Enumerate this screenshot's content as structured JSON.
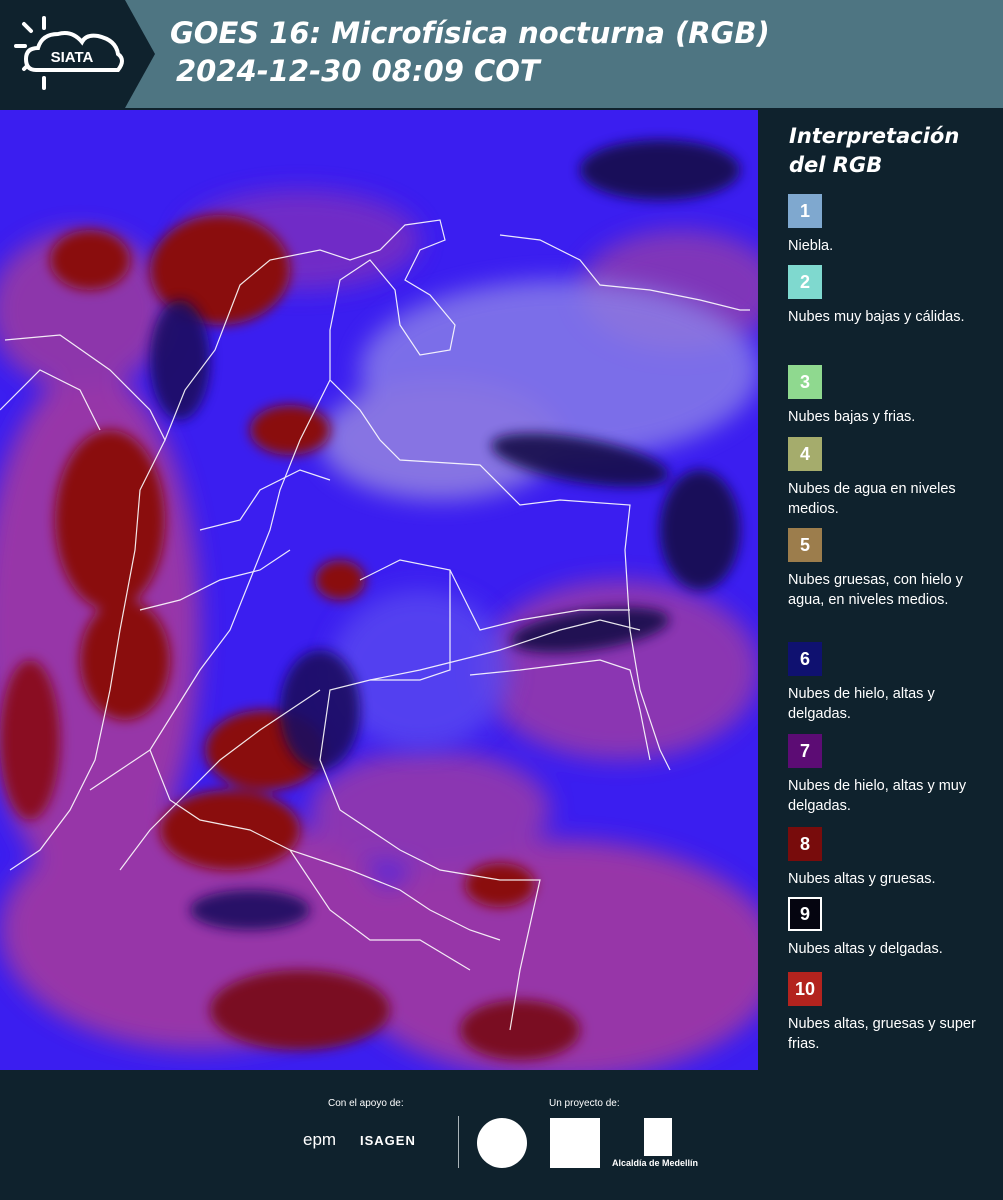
{
  "header": {
    "logo_text": "SIATA",
    "title_line1": "GOES 16: Microfísica nocturna (RGB)",
    "title_line2": "2024-12-30 08:09 COT",
    "background": "#4e7582"
  },
  "map": {
    "description_colors": {
      "background_blue": "#3b1ef0",
      "magenta": "#a83a9c",
      "dark_red": "#8a1010",
      "dark": "#1a1060",
      "lavender": "#8c82e8",
      "border_lines": "#ffffff"
    }
  },
  "legend": {
    "title": "Interpretación del RGB",
    "items": [
      {
        "number": "1",
        "label": "Niebla.",
        "color": "#7fa8cf"
      },
      {
        "number": "2",
        "label": "Nubes muy bajas y cálidas.",
        "color": "#7fd9cf"
      },
      {
        "number": "3",
        "label": "Nubes bajas y frias.",
        "color": "#8fd98f"
      },
      {
        "number": "4",
        "label": "Nubes de agua en niveles medios.",
        "color": "#a5ac6c"
      },
      {
        "number": "5",
        "label": "Nubes gruesas, con hielo y agua, en niveles medios.",
        "color": "#9c7d4c"
      },
      {
        "number": "6",
        "label": "Nubes de hielo, altas y delgadas.",
        "color": "#0f1170"
      },
      {
        "number": "7",
        "label": "Nubes de hielo, altas y muy delgadas.",
        "color": "#5c0c74"
      },
      {
        "number": "8",
        "label": "Nubes altas y gruesas.",
        "color": "#780c0c"
      },
      {
        "number": "9",
        "label": "Nubes altas y delgadas.",
        "color": "#050510"
      },
      {
        "number": "10",
        "label": "Nubes altas, gruesas y super frias.",
        "color": "#b3231e"
      }
    ]
  },
  "footer": {
    "support_label": "Con el apoyo de:",
    "project_label": "Un proyecto de:",
    "sponsor1": "epm",
    "sponsor2": "ISAGEN",
    "alcaldia": "Alcaldía de Medellín"
  }
}
